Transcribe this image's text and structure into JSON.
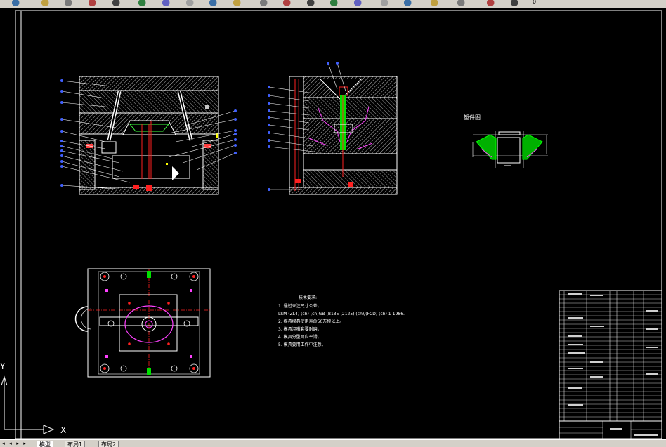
{
  "toolbar": {
    "icons": [
      "copy-icon",
      "paste-icon",
      "match-properties-icon",
      "layer-icon",
      "zoom-realtime-icon",
      "zoom-window-icon",
      "zoom-previous-icon",
      "pan-icon",
      "undo-icon",
      "redo-icon",
      "zoom-in-icon",
      "zoom-out-icon",
      "properties-icon",
      "design-center-icon",
      "tool-palettes-icon",
      "sheet-set-icon",
      "calculator-icon",
      "help-icon",
      "layers-icon",
      "bulb-icon",
      "lock-icon"
    ],
    "layer_value": "0"
  },
  "drawing": {
    "part_view_label": "塑件图",
    "notes_title": "技术要求:",
    "notes": [
      "1. 通过未注尺寸公差。",
      "LSM (ZL4) (ch) (ch)GB-(B135-(2125) (ch)/(FCD) (ch) 1-1986.",
      "2. 模具模具使用寿命50万模以上。",
      "3. 模具浇嘴套要耐磨。",
      "4. 模具分型面应平滑。",
      "5. 模具要用工作中注意。"
    ],
    "ucs": {
      "x_label": "X",
      "y_label": "Y"
    }
  },
  "statusbar": {
    "tabs": [
      "模型",
      "布局1",
      "布局2"
    ],
    "active_tab": 0
  },
  "colors": {
    "background": "#000000",
    "line": "#ffffff",
    "hatch": "#c8c8c8",
    "accent_red": "#ff2020",
    "accent_green": "#00e000",
    "accent_magenta": "#ff40ff",
    "leader_dot": "#4060ff"
  }
}
